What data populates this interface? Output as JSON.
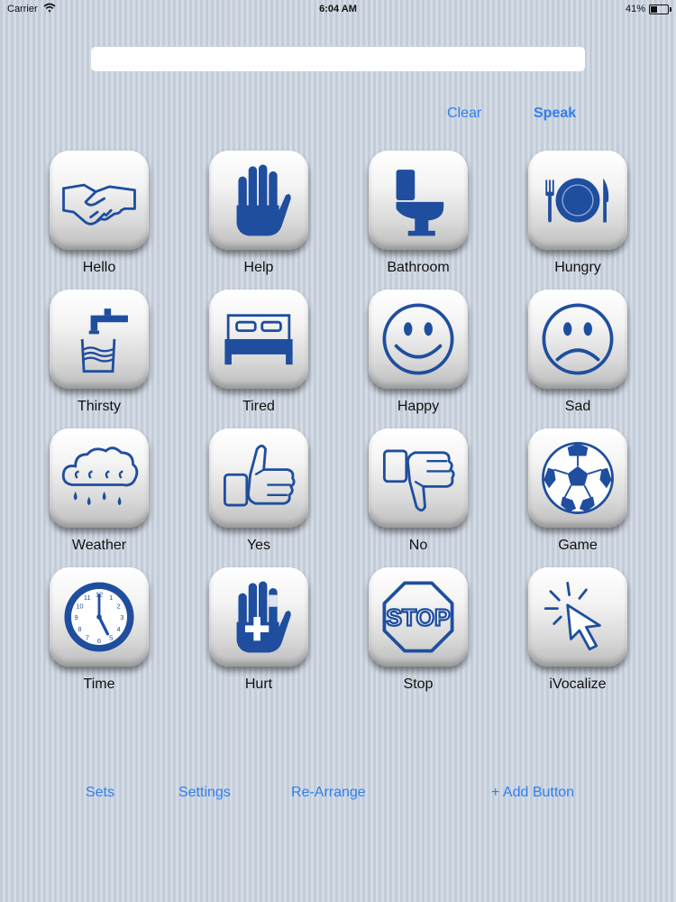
{
  "status_bar": {
    "carrier": "Carrier",
    "time": "6:04 AM",
    "battery": "41%",
    "battery_level": 0.41
  },
  "text_field": {
    "value": ""
  },
  "top_actions": {
    "clear": "Clear",
    "speak": "Speak"
  },
  "tiles": [
    {
      "label": "Hello",
      "icon": "handshake-icon"
    },
    {
      "label": "Help",
      "icon": "raised-hand-icon"
    },
    {
      "label": "Bathroom",
      "icon": "toilet-icon"
    },
    {
      "label": "Hungry",
      "icon": "plate-fork-knife-icon"
    },
    {
      "label": "Thirsty",
      "icon": "faucet-glass-icon"
    },
    {
      "label": "Tired",
      "icon": "bed-icon"
    },
    {
      "label": "Happy",
      "icon": "smiley-face-icon"
    },
    {
      "label": "Sad",
      "icon": "sad-face-icon"
    },
    {
      "label": "Weather",
      "icon": "rain-cloud-icon"
    },
    {
      "label": "Yes",
      "icon": "thumbs-up-icon"
    },
    {
      "label": "No",
      "icon": "thumbs-down-icon"
    },
    {
      "label": "Game",
      "icon": "soccer-ball-icon"
    },
    {
      "label": "Time",
      "icon": "clock-icon"
    },
    {
      "label": "Hurt",
      "icon": "bandaged-hand-icon"
    },
    {
      "label": "Stop",
      "icon": "stop-sign-icon",
      "sign_text": "STOP"
    },
    {
      "label": "iVocalize",
      "icon": "cursor-click-icon"
    }
  ],
  "bottom_actions": {
    "sets": "Sets",
    "settings": "Settings",
    "rearrange": "Re-Arrange",
    "add_button": "+ Add Button"
  },
  "colors": {
    "accent": "#2f7ff0",
    "icon_blue": "#1f4e9e",
    "tile_light": "#f4f4f4"
  }
}
